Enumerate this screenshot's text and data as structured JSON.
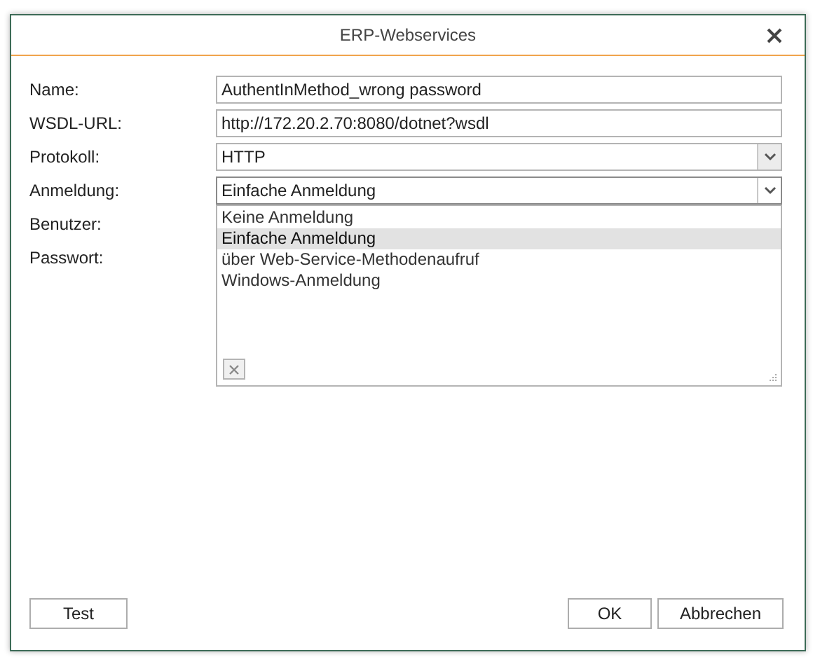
{
  "window": {
    "title": "ERP-Webservices"
  },
  "fields": [
    {
      "label": "Name:",
      "kind": "text",
      "value": "AuthentInMethod_wrong password"
    },
    {
      "label": "WSDL-URL:",
      "kind": "text",
      "value": "http://172.20.2.70:8080/dotnet?wsdl"
    },
    {
      "label": "Protokoll:",
      "kind": "combo",
      "value": "HTTP",
      "expanded": false
    },
    {
      "label": "Anmeldung:",
      "kind": "combo",
      "value": "Einfache Anmeldung",
      "expanded": true
    },
    {
      "label": "Benutzer:",
      "kind": "hidden"
    },
    {
      "label": "Passwort:",
      "kind": "hidden"
    }
  ],
  "dropdown": {
    "items": [
      {
        "label": "Keine Anmeldung",
        "selected": false
      },
      {
        "label": "Einfache Anmeldung",
        "selected": true
      },
      {
        "label": "über Web-Service-Methodenaufruf",
        "selected": false
      },
      {
        "label": "Windows-Anmeldung",
        "selected": false
      }
    ]
  },
  "buttons": {
    "left": [
      "Test"
    ],
    "right": [
      "OK",
      "Abbrechen"
    ]
  }
}
